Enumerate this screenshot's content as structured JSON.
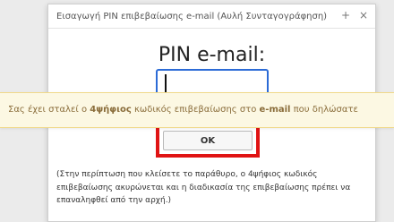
{
  "dialog": {
    "title": "Εισαγωγή PIN επιβεβαίωσης e-mail (Αυλή Συνταγογράφηση)",
    "plus_symbol": "+",
    "close_symbol": "×",
    "heading": "PIN e-mail:",
    "pin_value": "",
    "ok_label": "OK",
    "note": "(Στην περίπτωση που κλείσετε το παράθυρο, ο 4ψήφιος κωδικός επιβεβαίωσης ακυρώνεται και η διαδικασία της επιβεβαίωσης πρέπει να επαναληφθεί από την αρχή.)"
  },
  "toast": {
    "part1": "Σας έχει σταλεί ο ",
    "bold1": "4ψήφιος",
    "part2": " κωδικός επιβεβαίωσης στο ",
    "bold2": "e-mail",
    "part3": " που δηλώσατε"
  },
  "colors": {
    "focus_border": "#2c6bd6",
    "highlight": "#e01414",
    "toast_background": "#fcf8e3",
    "toast_text": "#8a6d3b"
  }
}
